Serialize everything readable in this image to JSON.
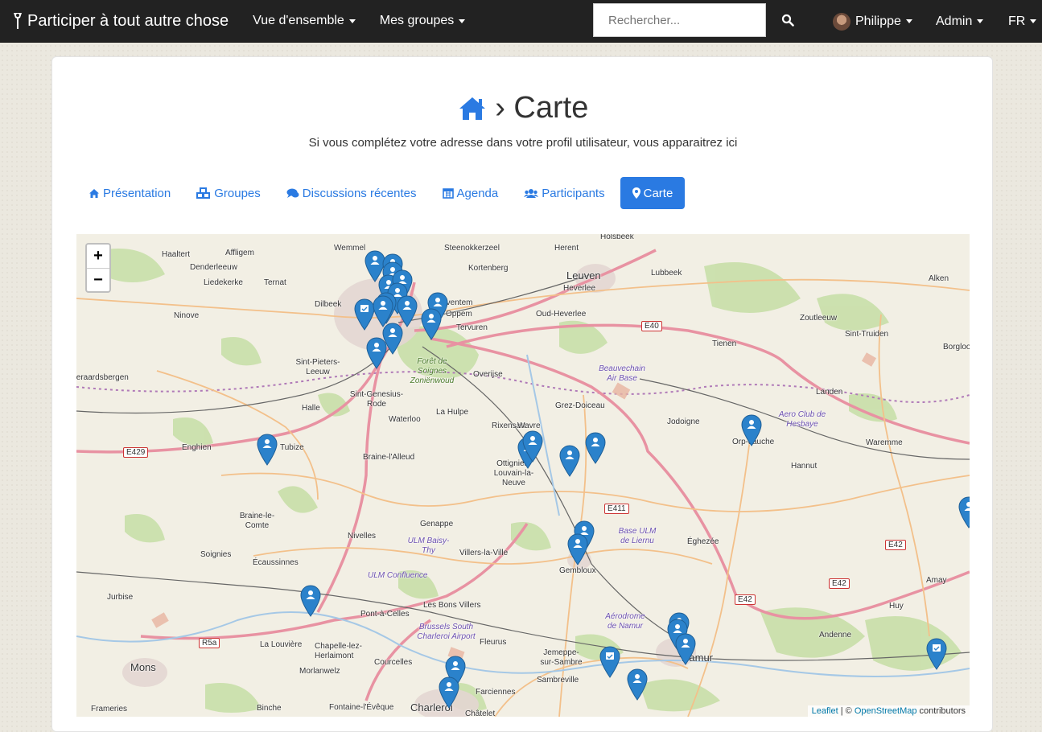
{
  "navbar": {
    "brand": "Participer à tout autre chose",
    "menu": [
      "Vue d'ensemble",
      "Mes groupes"
    ],
    "search_placeholder": "Rechercher...",
    "user": "Philippe",
    "admin": "Admin",
    "lang": "FR"
  },
  "page": {
    "title_sep": "›",
    "title": "Carte",
    "subtitle": "Si vous complétez votre adresse dans votre profil utilisateur, vous apparaitrez ici"
  },
  "tabs": [
    {
      "label": "Présentation",
      "icon": "home-icon"
    },
    {
      "label": "Groupes",
      "icon": "cubes-icon"
    },
    {
      "label": "Discussions récentes",
      "icon": "comments-icon"
    },
    {
      "label": "Agenda",
      "icon": "calendar-icon"
    },
    {
      "label": "Participants",
      "icon": "users-icon"
    },
    {
      "label": "Carte",
      "icon": "map-marker-icon"
    }
  ],
  "map": {
    "zoom_in": "+",
    "zoom_out": "−",
    "attribution": {
      "leaflet": "Leaflet",
      "sep": " | © ",
      "osm": "OpenStreetMap",
      "rest": " contributors"
    },
    "places": [
      {
        "name": "Holsbeek"
      },
      {
        "name": "Steenokkerzeel"
      },
      {
        "name": "Haaltert"
      },
      {
        "name": "Affligem"
      },
      {
        "name": "Wemmel"
      },
      {
        "name": "Kortenberg"
      },
      {
        "name": "Herent"
      },
      {
        "name": "Denderleeuw"
      },
      {
        "name": "Liedekerke"
      },
      {
        "name": "Ternat"
      },
      {
        "name": "Leuven"
      },
      {
        "name": "Heverlee"
      },
      {
        "name": "Lubbeek"
      },
      {
        "name": "Alken"
      },
      {
        "name": "Dilbeek"
      },
      {
        "name": "Zaventem"
      },
      {
        "name": "Oppem"
      },
      {
        "name": "Oud-Heverlee"
      },
      {
        "name": "Ninove"
      },
      {
        "name": "Zoutleeuw"
      },
      {
        "name": "Sint-Truiden"
      },
      {
        "name": "Tienen"
      },
      {
        "name": "Borgloo"
      },
      {
        "name": "Tervuren"
      },
      {
        "name": "Sint-Pieters-Leeuw"
      },
      {
        "name": "Overijse"
      },
      {
        "name": "Geraardsbergen"
      },
      {
        "name": "Sint-Genesius-Rode"
      },
      {
        "name": "Landen"
      },
      {
        "name": "Halle"
      },
      {
        "name": "Waterloo"
      },
      {
        "name": "La Hulpe"
      },
      {
        "name": "Rixensart"
      },
      {
        "name": "Wavre"
      },
      {
        "name": "Grez-Doiceau"
      },
      {
        "name": "Jodoigne"
      },
      {
        "name": "Orp-Jauche"
      },
      {
        "name": "Waremme"
      },
      {
        "name": "Enghien"
      },
      {
        "name": "Tubize"
      },
      {
        "name": "Braine-l'Alleud"
      },
      {
        "name": "Ottignies-Louvain-la-Neuve"
      },
      {
        "name": "Hannut"
      },
      {
        "name": "Braine-le-Comte"
      },
      {
        "name": "Genappe"
      },
      {
        "name": "Nivelles"
      },
      {
        "name": "Éghezée"
      },
      {
        "name": "Soignies"
      },
      {
        "name": "Villers-la-Ville"
      },
      {
        "name": "Gembloux"
      },
      {
        "name": "Écaussinnes"
      },
      {
        "name": "Amay"
      },
      {
        "name": "Jurbise"
      },
      {
        "name": "Les Bons Villers"
      },
      {
        "name": "Huy"
      },
      {
        "name": "Pont-à-Celles"
      },
      {
        "name": "Andenne"
      },
      {
        "name": "La Louvière"
      },
      {
        "name": "Chapelle-lez-Herlaimont"
      },
      {
        "name": "Fleurus"
      },
      {
        "name": "Jemeppe-sur-Sambre"
      },
      {
        "name": "Mons"
      },
      {
        "name": "Morlanwelz"
      },
      {
        "name": "Courcelles"
      },
      {
        "name": "Sambreville"
      },
      {
        "name": "Namur"
      },
      {
        "name": "Farciennes"
      },
      {
        "name": "Frameries"
      },
      {
        "name": "Binche"
      },
      {
        "name": "Fontaine-l'Évêque"
      },
      {
        "name": "Charleroi"
      },
      {
        "name": "Châtelet"
      }
    ],
    "airfields": [
      {
        "name": "Forêt de Soignes Zoniënwoud"
      },
      {
        "name": "Beauvechain Air Base"
      },
      {
        "name": "Aero Club de Hesbaye"
      },
      {
        "name": "ULM Baisy-Thy"
      },
      {
        "name": "Base ULM de Liernu"
      },
      {
        "name": "ULM Confluence"
      },
      {
        "name": "Aérodrome de Namur"
      },
      {
        "name": "Brussels South Charleroi Airport"
      }
    ],
    "roads": [
      {
        "ref": "E40"
      },
      {
        "ref": "E429"
      },
      {
        "ref": "E411"
      },
      {
        "ref": "E42"
      },
      {
        "ref": "E42"
      },
      {
        "ref": "E42"
      },
      {
        "ref": "R5a"
      }
    ],
    "markers": [
      {
        "kind": "person"
      },
      {
        "kind": "person"
      },
      {
        "kind": "person"
      },
      {
        "kind": "person"
      },
      {
        "kind": "person"
      },
      {
        "kind": "person"
      },
      {
        "kind": "person"
      },
      {
        "kind": "event"
      },
      {
        "kind": "person"
      },
      {
        "kind": "person"
      },
      {
        "kind": "person"
      },
      {
        "kind": "person"
      },
      {
        "kind": "person"
      },
      {
        "kind": "person"
      },
      {
        "kind": "person"
      },
      {
        "kind": "person"
      },
      {
        "kind": "person"
      },
      {
        "kind": "person"
      },
      {
        "kind": "person"
      },
      {
        "kind": "person"
      },
      {
        "kind": "person"
      },
      {
        "kind": "person"
      },
      {
        "kind": "person"
      },
      {
        "kind": "person"
      },
      {
        "kind": "person"
      },
      {
        "kind": "event"
      },
      {
        "kind": "person"
      },
      {
        "kind": "event"
      },
      {
        "kind": "person"
      },
      {
        "kind": "person"
      },
      {
        "kind": "person"
      },
      {
        "kind": "person"
      }
    ]
  },
  "colors": {
    "primary": "#2a7ae2",
    "navbar": "#222222",
    "marker": "#2b82cb"
  }
}
